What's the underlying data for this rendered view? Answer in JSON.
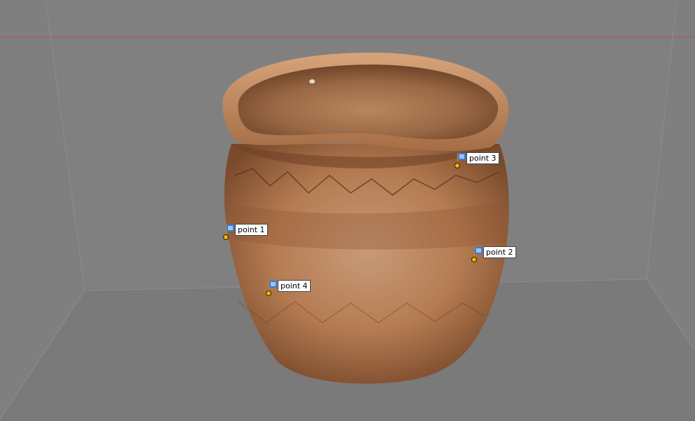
{
  "viewport": {
    "background": "#7f7f7f",
    "axis_line_color": "#c0504d"
  },
  "points": [
    {
      "id": "p1",
      "label": "point 1"
    },
    {
      "id": "p2",
      "label": "point 2"
    },
    {
      "id": "p3",
      "label": "point 3"
    },
    {
      "id": "p4",
      "label": "point 4"
    }
  ],
  "icons": {
    "marker_flag": "flag-icon",
    "marker_pin": "pin-icon"
  },
  "colors": {
    "pin": "#f2b400",
    "flag": "#3a7bd5",
    "label_bg": "#ffffff"
  }
}
